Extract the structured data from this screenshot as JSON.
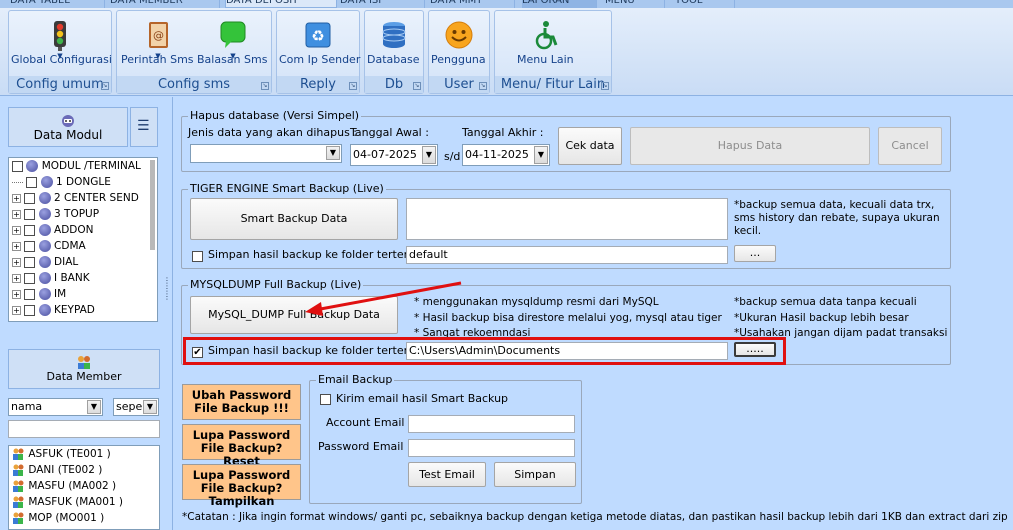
{
  "tabs": [
    "DATA TABEL",
    "DATA MEMBER",
    "DATA DEPOSIT",
    "DATA ISI",
    "DATA MMT",
    "LAPORAN",
    "MENU",
    "TOOL"
  ],
  "ribbon": {
    "groups": [
      {
        "label": "Config umum",
        "buttons": [
          {
            "label": "Global Configurasi",
            "icon": "traffic-light-icon"
          }
        ]
      },
      {
        "label": "Config sms",
        "buttons": [
          {
            "label": "Perintah Sms",
            "icon": "sms-book-icon"
          },
          {
            "label": "Balasan Sms",
            "icon": "speech-bubble-icon"
          }
        ]
      },
      {
        "label": "Reply",
        "buttons": [
          {
            "label": "Com Ip Sender",
            "icon": "recycle-icon"
          }
        ]
      },
      {
        "label": "Db",
        "buttons": [
          {
            "label": "Database",
            "icon": "database-icon"
          }
        ]
      },
      {
        "label": "User",
        "buttons": [
          {
            "label": "Pengguna",
            "icon": "smiley-icon"
          }
        ]
      },
      {
        "label": "Menu/ Fitur Lain",
        "buttons": [
          {
            "label": "Menu Lain",
            "icon": "wheelchair-icon"
          }
        ]
      }
    ]
  },
  "left": {
    "data_modul": "Data Modul",
    "tree": [
      {
        "label": "MODUL /TERMINAL",
        "root": true
      },
      {
        "label": "1 DONGLE"
      },
      {
        "label": "2 CENTER SEND",
        "exp": true
      },
      {
        "label": "3 TOPUP",
        "exp": true
      },
      {
        "label": "ADDON",
        "exp": true
      },
      {
        "label": "CDMA",
        "exp": true
      },
      {
        "label": "DIAL",
        "exp": true
      },
      {
        "label": "I BANK",
        "exp": true
      },
      {
        "label": "IM",
        "exp": true
      },
      {
        "label": "KEYPAD",
        "exp": true
      }
    ],
    "data_member": "Data Member",
    "filter_field": "nama",
    "filter_mode": "seper",
    "search_value": "",
    "members": [
      "ASFUK (TE001 )",
      "DANI (TE002 )",
      "MASFU (MA002 )",
      "MASFUK (MA001 )",
      "MOP (MO001 )"
    ]
  },
  "hapus": {
    "title": "Hapus database (Versi Simpel)",
    "jenis_label": "Jenis data yang akan dihapus :",
    "jenis_value": "",
    "awal_label": "Tanggal Awal :",
    "awal_value": "04-07-2025",
    "sd": "s/d",
    "akhir_label": "Tanggal Akhir :",
    "akhir_value": "04-11-2025",
    "cek": "Cek data",
    "hapus_btn": "Hapus Data",
    "cancel": "Cancel"
  },
  "tiger": {
    "title": "TIGER ENGINE Smart Backup (Live)",
    "smart_btn": "Smart Backup Data",
    "note": "*backup semua data, kecuali  data trx, sms history dan rebate, supaya ukuran kecil.",
    "simpan_label": "Simpan hasil backup ke folder tertentu :",
    "folder": "default",
    "browse": "..."
  },
  "mysql": {
    "title": "MYSQLDUMP Full Backup (Live)",
    "dump_btn": "MySQL_DUMP Full Backup Data",
    "notes_left": [
      "* menggunakan mysqldump resmi dari MySQL",
      "* Hasil backup bisa direstore melalui yog, mysql atau tiger",
      "* Sangat rekoemndasi"
    ],
    "notes_right": [
      "*backup semua data tanpa kecuali",
      "*Ukuran Hasil backup lebih besar",
      "*Usahakan jangan dijam padat transaksi"
    ],
    "simpan_label": "Simpan hasil backup ke folder tertentu :",
    "folder": "C:\\Users\\Admin\\Documents",
    "browse": "....."
  },
  "pw_buttons": [
    "Ubah Password File Backup !!!",
    "Lupa Password File Backup? Reset",
    "Lupa Password File Backup? Tampilkan"
  ],
  "email": {
    "title": "Email Backup",
    "kirim": "Kirim email hasil Smart Backup",
    "account_label": "Account Email :",
    "account_value": "",
    "password_label": "Password Email :",
    "password_value": "",
    "test": "Test Email",
    "simpan": "Simpan"
  },
  "footer": "*Catatan : Jika  ingin format windows/ ganti pc, sebaiknya backup dengan ketiga metode diatas, dan pastikan hasil backup lebih dari 1KB dan extract dari zip",
  "colors": {
    "highlight_box": "#e01010",
    "arrow": "#e01010",
    "orange_button": "#ffc58a"
  }
}
